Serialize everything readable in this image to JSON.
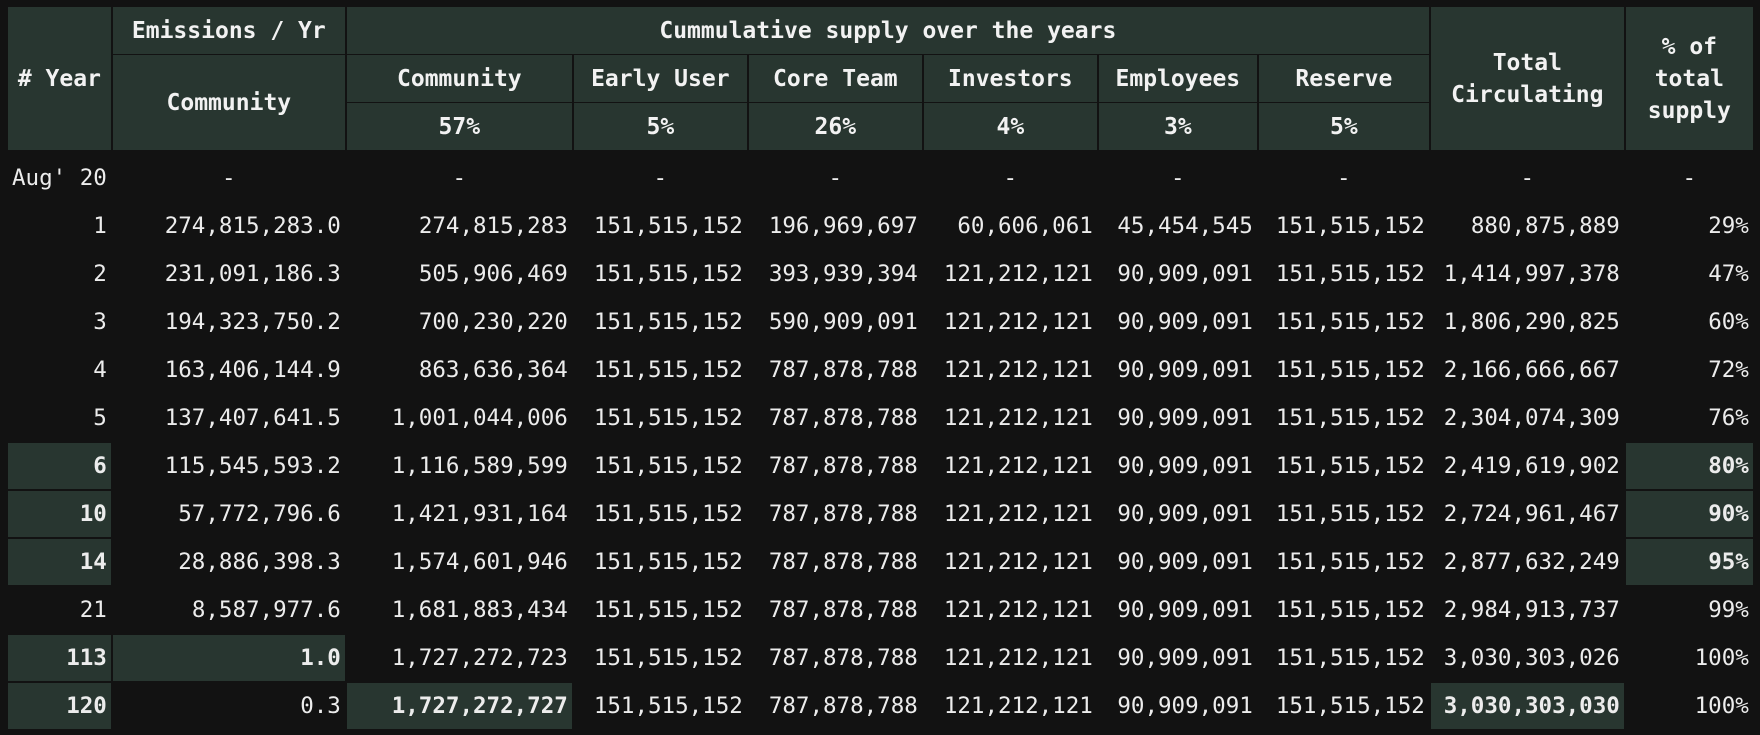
{
  "header": {
    "year": "# Year",
    "emissions": "Emissions / Yr",
    "emissions_sub": "Community",
    "cumulative": "Cummulative supply over the years",
    "groups": [
      {
        "name": "Community",
        "pct": "57%"
      },
      {
        "name": "Early User",
        "pct": "5%"
      },
      {
        "name": "Core Team",
        "pct": "26%"
      },
      {
        "name": "Investors",
        "pct": "4%"
      },
      {
        "name": "Employees",
        "pct": "3%"
      },
      {
        "name": "Reserve",
        "pct": "5%"
      }
    ],
    "total_line1": "Total",
    "total_line2": "Circulating",
    "pct_line1": "% of",
    "pct_line2": "total",
    "pct_line3": "supply"
  },
  "rows": [
    {
      "year": "Aug' 20",
      "emission": "-",
      "community": "-",
      "early_user": "-",
      "core_team": "-",
      "investors": "-",
      "employees": "-",
      "reserve": "-",
      "total": "-",
      "pct": "-"
    },
    {
      "year": "1",
      "emission": "274,815,283.0",
      "community": "274,815,283",
      "early_user": "151,515,152",
      "core_team": "196,969,697",
      "investors": "60,606,061",
      "employees": "45,454,545",
      "reserve": "151,515,152",
      "total": "880,875,889",
      "pct": "29%"
    },
    {
      "year": "2",
      "emission": "231,091,186.3",
      "community": "505,906,469",
      "early_user": "151,515,152",
      "core_team": "393,939,394",
      "investors": "121,212,121",
      "employees": "90,909,091",
      "reserve": "151,515,152",
      "total": "1,414,997,378",
      "pct": "47%"
    },
    {
      "year": "3",
      "emission": "194,323,750.2",
      "community": "700,230,220",
      "early_user": "151,515,152",
      "core_team": "590,909,091",
      "investors": "121,212,121",
      "employees": "90,909,091",
      "reserve": "151,515,152",
      "total": "1,806,290,825",
      "pct": "60%"
    },
    {
      "year": "4",
      "emission": "163,406,144.9",
      "community": "863,636,364",
      "early_user": "151,515,152",
      "core_team": "787,878,788",
      "investors": "121,212,121",
      "employees": "90,909,091",
      "reserve": "151,515,152",
      "total": "2,166,666,667",
      "pct": "72%"
    },
    {
      "year": "5",
      "emission": "137,407,641.5",
      "community": "1,001,044,006",
      "early_user": "151,515,152",
      "core_team": "787,878,788",
      "investors": "121,212,121",
      "employees": "90,909,091",
      "reserve": "151,515,152",
      "total": "2,304,074,309",
      "pct": "76%"
    },
    {
      "year": "6",
      "emission": "115,545,593.2",
      "community": "1,116,589,599",
      "early_user": "151,515,152",
      "core_team": "787,878,788",
      "investors": "121,212,121",
      "employees": "90,909,091",
      "reserve": "151,515,152",
      "total": "2,419,619,902",
      "pct": "80%"
    },
    {
      "year": "10",
      "emission": "57,772,796.6",
      "community": "1,421,931,164",
      "early_user": "151,515,152",
      "core_team": "787,878,788",
      "investors": "121,212,121",
      "employees": "90,909,091",
      "reserve": "151,515,152",
      "total": "2,724,961,467",
      "pct": "90%"
    },
    {
      "year": "14",
      "emission": "28,886,398.3",
      "community": "1,574,601,946",
      "early_user": "151,515,152",
      "core_team": "787,878,788",
      "investors": "121,212,121",
      "employees": "90,909,091",
      "reserve": "151,515,152",
      "total": "2,877,632,249",
      "pct": "95%"
    },
    {
      "year": "21",
      "emission": "8,587,977.6",
      "community": "1,681,883,434",
      "early_user": "151,515,152",
      "core_team": "787,878,788",
      "investors": "121,212,121",
      "employees": "90,909,091",
      "reserve": "151,515,152",
      "total": "2,984,913,737",
      "pct": "99%"
    },
    {
      "year": "113",
      "emission": "1.0",
      "community": "1,727,272,723",
      "early_user": "151,515,152",
      "core_team": "787,878,788",
      "investors": "121,212,121",
      "employees": "90,909,091",
      "reserve": "151,515,152",
      "total": "3,030,303,026",
      "pct": "100%"
    },
    {
      "year": "120",
      "emission": "0.3",
      "community": "1,727,272,727",
      "early_user": "151,515,152",
      "core_team": "787,878,788",
      "investors": "121,212,121",
      "employees": "90,909,091",
      "reserve": "151,515,152",
      "total": "3,030,303,030",
      "pct": "100%"
    }
  ],
  "highlights": {
    "6": [
      "year",
      "pct"
    ],
    "10": [
      "year",
      "pct"
    ],
    "14": [
      "year",
      "pct"
    ],
    "113": [
      "year",
      "emission"
    ],
    "120": [
      "year",
      "community",
      "total"
    ]
  },
  "colors": {
    "background": "#121212",
    "header_bg": "#283630",
    "highlight_bg": "#283630",
    "text": "#ececec"
  }
}
